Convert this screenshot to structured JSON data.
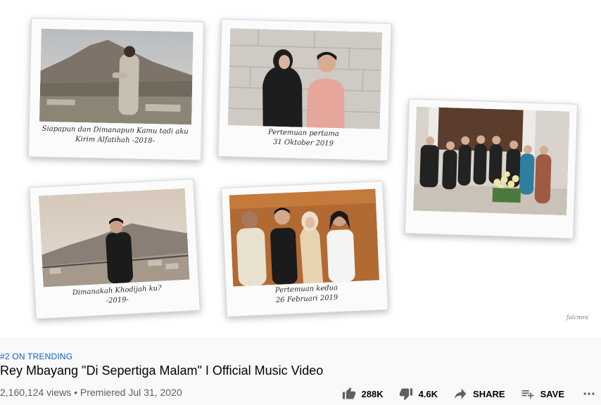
{
  "frame": {
    "photos": [
      {
        "caption_line1": "Siapapun dan Dimanapun Kamu tadi aku",
        "caption_line2": "Kirim Alfatihah -2018-"
      },
      {
        "caption_line1": "Pertemuan pertama",
        "caption_line2": "31 Oktober 2019"
      },
      {
        "caption_line1": "",
        "caption_line2": ""
      },
      {
        "caption_line1": "Dimanakah Khodijah ku?",
        "caption_line2": "-2019-"
      },
      {
        "caption_line1": "Pertemuan kedua",
        "caption_line2": "26 Februari 2019"
      }
    ],
    "signature": "falcmra"
  },
  "trending_badge": "#2 ON TRENDING",
  "title": "Rey Mbayang \"Di Sepertiga Malam\" I Official Music Video",
  "meta": {
    "views": "2,160,124 views",
    "separator": " • ",
    "premiered": "Premiered Jul 31, 2020"
  },
  "actions": {
    "like_count": "288K",
    "dislike_count": "4.6K",
    "share_label": "SHARE",
    "save_label": "SAVE"
  },
  "icons": {
    "like": "thumb-up-icon",
    "dislike": "thumb-down-icon",
    "share": "share-arrow-icon",
    "save": "playlist-add-icon",
    "more": "more-horizontal-icon"
  },
  "colors": {
    "trending_link": "#065fd4",
    "title": "#030303",
    "meta": "#606060",
    "icon": "#606060"
  }
}
